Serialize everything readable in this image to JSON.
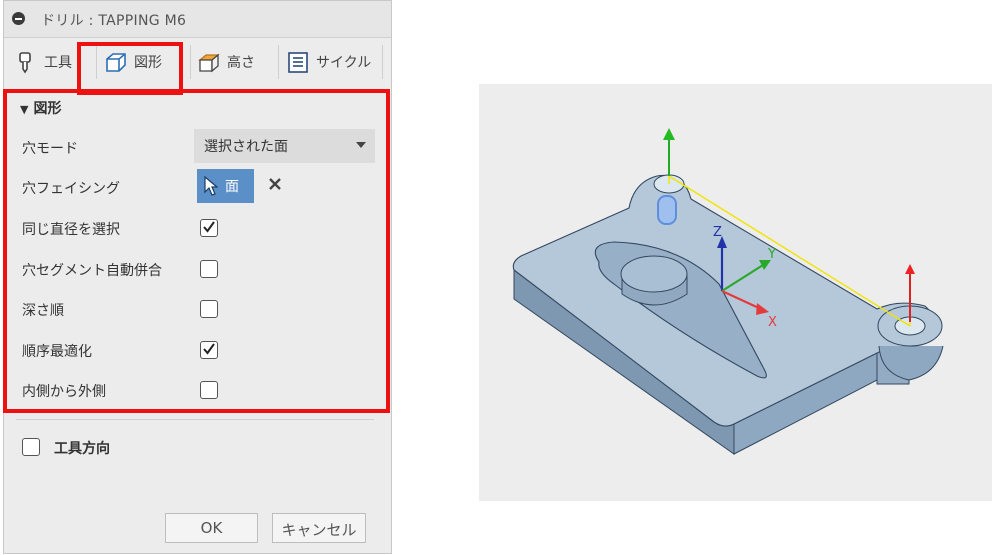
{
  "dialog": {
    "title": "ドリル : TAPPING M6"
  },
  "tabs": [
    {
      "label": "工具",
      "icon": "drill-tool-icon"
    },
    {
      "label": "図形",
      "icon": "geometry-cube-icon"
    },
    {
      "label": "高さ",
      "icon": "height-cube-icon"
    },
    {
      "label": "サイクル",
      "icon": "cycle-icon"
    }
  ],
  "geometry": {
    "section_label": "図形",
    "hole_mode": {
      "label": "穴モード",
      "value": "選択された面"
    },
    "hole_facing": {
      "label": "穴フェイシング",
      "button_label": "面"
    },
    "same_diameter": {
      "label": "同じ直径を選択",
      "checked": true
    },
    "auto_join": {
      "label": "穴セグメント自動併合",
      "checked": false
    },
    "depth_order": {
      "label": "深さ順",
      "checked": false
    },
    "optimize_order": {
      "label": "順序最適化",
      "checked": true
    },
    "inside_out": {
      "label": "内側から外側",
      "checked": false
    }
  },
  "tool_orientation": {
    "label": "工具方向",
    "checked": false
  },
  "footer": {
    "ok_label": "OK",
    "cancel_label": "キャンセル"
  },
  "viewport": {
    "axis_x": "X",
    "axis_y": "Y",
    "axis_z": "Z"
  },
  "colors": {
    "highlight": "#ee1111",
    "accent_button": "#5b8fc7",
    "part_face": "#a9bfd4",
    "axis_x": "#e33b3b",
    "axis_y": "#2aa82a",
    "axis_z": "#2233aa"
  }
}
